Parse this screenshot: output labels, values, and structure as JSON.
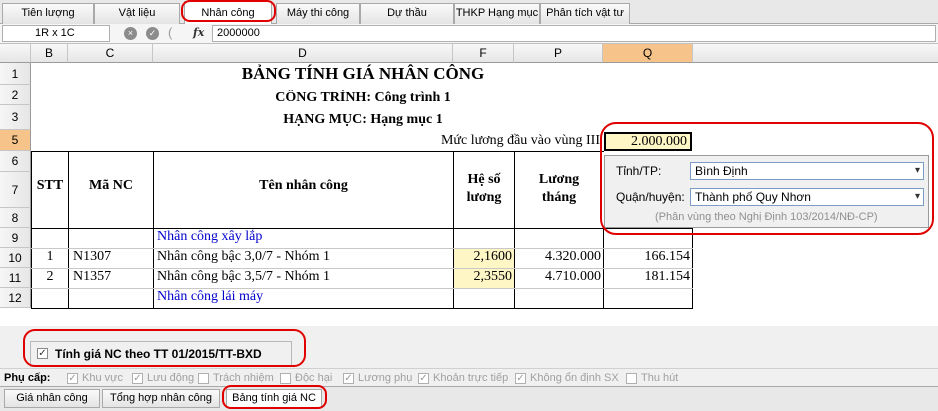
{
  "top_tabs": [
    "Tiên lượng",
    "Vật liệu",
    "Nhân công",
    "Máy thi công",
    "Dự thầu",
    "THKP Hạng mục",
    "Phân tích vật tư"
  ],
  "formula_bar": {
    "name_box": "1R x 1C",
    "fx": "fx",
    "value": "2000000",
    "cancel_icon": "×",
    "ok_icon": "✓"
  },
  "columns": [
    "B",
    "C",
    "D",
    "F",
    "P",
    "Q"
  ],
  "rows": [
    "1",
    "2",
    "3",
    "5",
    "6",
    "7",
    "8",
    "9",
    "10",
    "11",
    "12"
  ],
  "sheet": {
    "title": "BẢNG TÍNH GIÁ NHÂN CÔNG",
    "project": "CÔNG TRÌNH: Công trình 1",
    "item": "HẠNG MỤC: Hạng mục 1",
    "wage_label": "Mức lương đầu vào vùng III",
    "wage_value": "2.000.000",
    "headers": {
      "stt": "STT",
      "ma_nc": "Mã NC",
      "ten_nc": "Tên nhân công",
      "he_so_1": "Hệ số",
      "he_so_2": "lương",
      "luong_1": "Lương",
      "luong_2": "tháng"
    },
    "group1": "Nhân công xây lắp",
    "group2": "Nhân công lái máy",
    "items": [
      {
        "stt": "1",
        "code": "N1307",
        "name": "Nhân công bậc 3,0/7 - Nhóm 1",
        "coef": "2,1600",
        "monthly": "4.320.000",
        "daily": "166.154"
      },
      {
        "stt": "2",
        "code": "N1357",
        "name": "Nhân công bậc 3,5/7 - Nhóm 1",
        "coef": "2,3550",
        "monthly": "4.710.000",
        "daily": "181.154"
      }
    ]
  },
  "region": {
    "province_label": "Tỉnh/TP:",
    "province_value": "Bình Định",
    "district_label": "Quận/huyện:",
    "district_value": "Thành phố Quy Nhơn",
    "note": "(Phân vùng theo Nghị Định 103/2014/NĐ-CP)"
  },
  "tt_checkbox": {
    "label": "Tính giá NC theo TT 01/2015/TT-BXD",
    "checked": true
  },
  "phu_cap": {
    "label": "Phụ cấp:",
    "items": [
      {
        "label": "Khu vực",
        "checked": true
      },
      {
        "label": "Lưu động",
        "checked": true
      },
      {
        "label": "Trách nhiệm",
        "checked": false
      },
      {
        "label": "Độc hại",
        "checked": false
      },
      {
        "label": "Lương phụ",
        "checked": true
      },
      {
        "label": "Khoản trực tiếp",
        "checked": true
      },
      {
        "label": "Không ổn định SX",
        "checked": true
      },
      {
        "label": "Thu hút",
        "checked": false
      }
    ]
  },
  "bottom_tabs": [
    "Giá nhân công",
    "Tổng hợp nhân công",
    "Bảng tính giá NC"
  ],
  "colors": {
    "highlight_cell": "#fff6c6",
    "blue_text": "#0000cc",
    "red_circle": "#e00000",
    "selected_header": "#f6c48a"
  }
}
